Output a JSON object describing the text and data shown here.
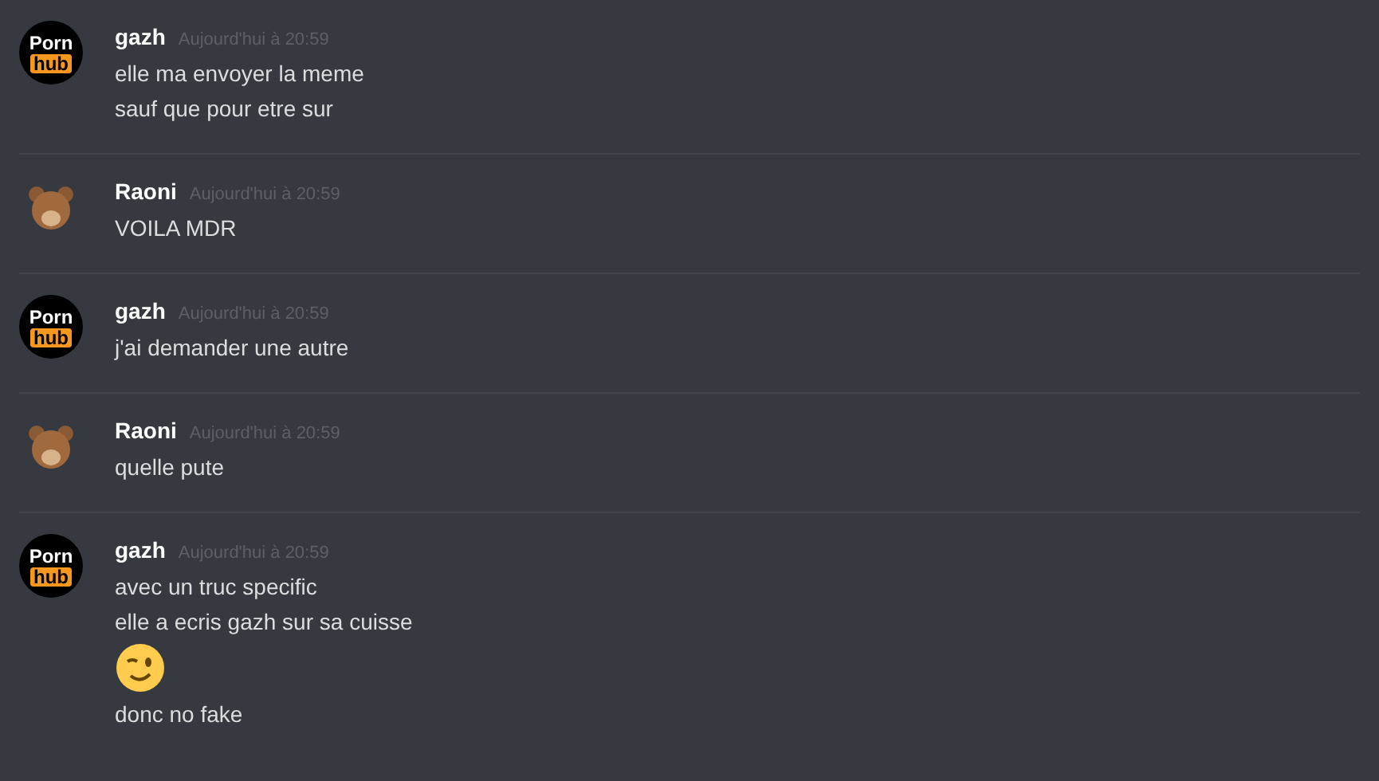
{
  "messages": [
    {
      "author": "gazh",
      "timestamp": "Aujourd'hui à 20:59",
      "avatar": {
        "kind": "logo",
        "words": [
          "Porn",
          "hub"
        ]
      },
      "lines": [
        {
          "kind": "text",
          "text": "elle ma envoyer la meme"
        },
        {
          "kind": "text",
          "text": "sauf que pour etre sur"
        }
      ]
    },
    {
      "author": "Raoni",
      "timestamp": "Aujourd'hui à 20:59",
      "avatar": {
        "kind": "bear"
      },
      "lines": [
        {
          "kind": "text",
          "text": "VOILA MDR"
        }
      ]
    },
    {
      "author": "gazh",
      "timestamp": "Aujourd'hui à 20:59",
      "avatar": {
        "kind": "logo",
        "words": [
          "Porn",
          "hub"
        ]
      },
      "lines": [
        {
          "kind": "text",
          "text": "j'ai demander une autre"
        }
      ]
    },
    {
      "author": "Raoni",
      "timestamp": "Aujourd'hui à 20:59",
      "avatar": {
        "kind": "bear"
      },
      "lines": [
        {
          "kind": "text",
          "text": "quelle pute"
        }
      ]
    },
    {
      "author": "gazh",
      "timestamp": "Aujourd'hui à 20:59",
      "avatar": {
        "kind": "logo",
        "words": [
          "Porn",
          "hub"
        ]
      },
      "lines": [
        {
          "kind": "text",
          "text": "avec un truc specific"
        },
        {
          "kind": "text",
          "text": "elle a ecris gazh sur sa cuisse"
        },
        {
          "kind": "emoji"
        },
        {
          "kind": "text",
          "text": "donc no fake"
        }
      ]
    }
  ]
}
